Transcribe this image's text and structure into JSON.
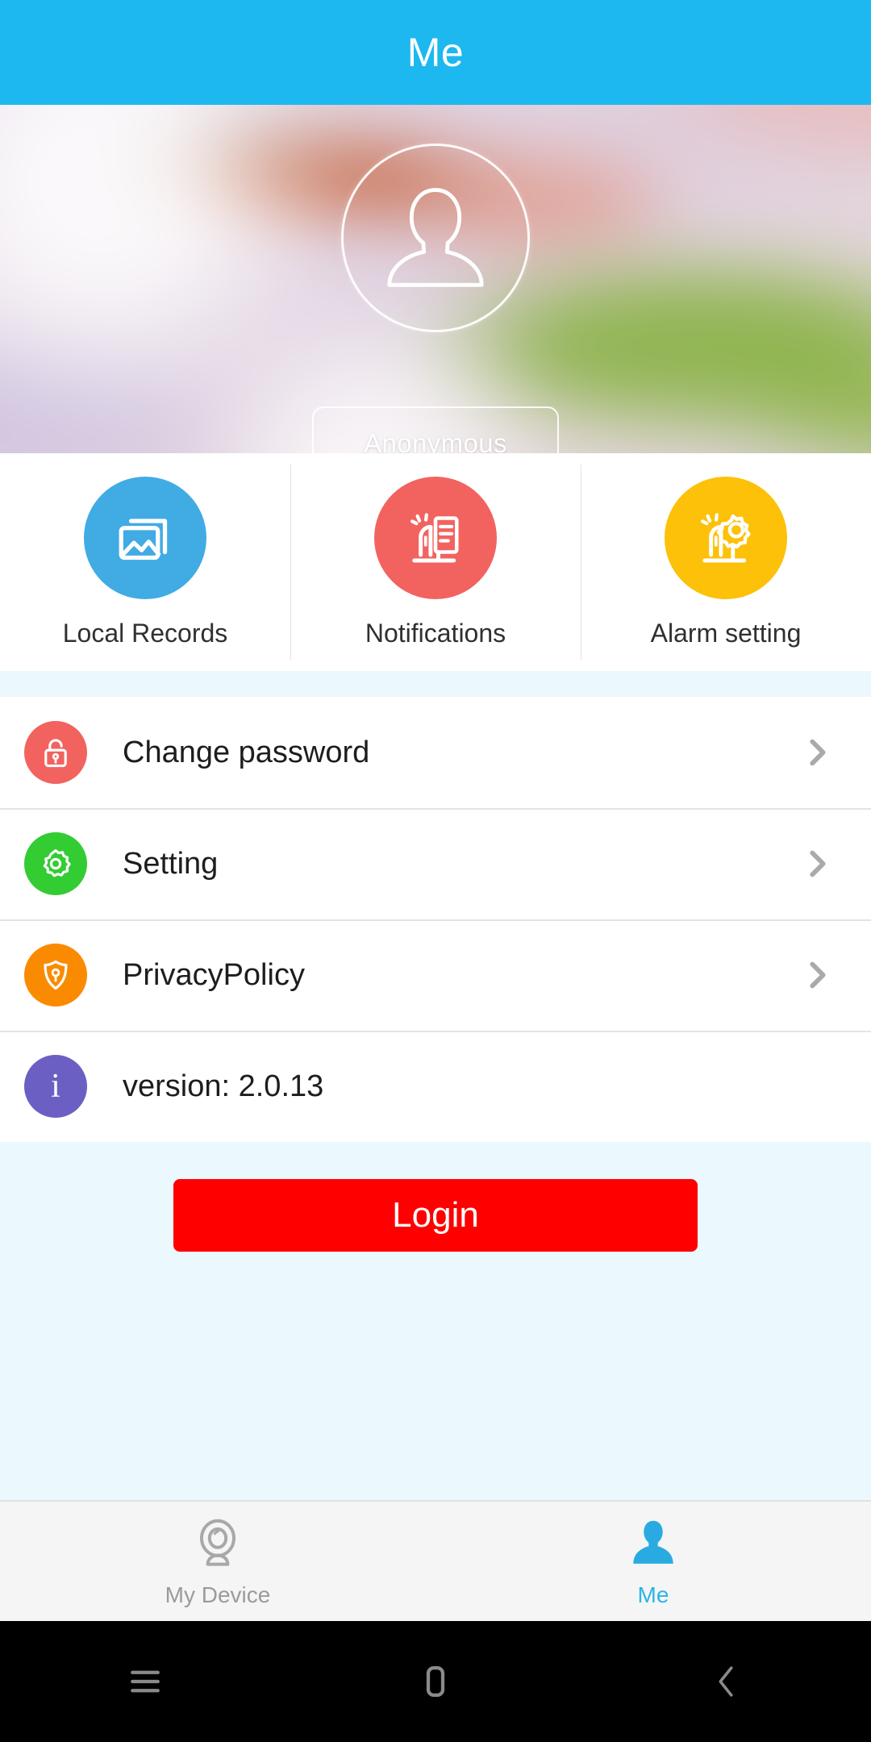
{
  "header": {
    "title": "Me"
  },
  "profile": {
    "avatar_icon": "person-outline-icon",
    "name_label": "Anonymous"
  },
  "quick_actions": [
    {
      "label": "Local Records",
      "icon": "gallery-icon",
      "color": "#41ABE4"
    },
    {
      "label": "Notifications",
      "icon": "siren-document-icon",
      "color": "#F2635F"
    },
    {
      "label": "Alarm setting",
      "icon": "siren-gear-icon",
      "color": "#FCC108"
    }
  ],
  "menu": [
    {
      "label": "Change password",
      "icon": "lock-icon",
      "color": "#F2635F",
      "chevron": true
    },
    {
      "label": "Setting",
      "icon": "gear-icon",
      "color": "#33CC33",
      "chevron": true
    },
    {
      "label": "PrivacyPolicy",
      "icon": "shield-icon",
      "color": "#FA8B00",
      "chevron": true
    },
    {
      "label": "version: 2.0.13",
      "icon": "info-icon",
      "color": "#6B5FC4",
      "chevron": false
    }
  ],
  "login": {
    "label": "Login",
    "color": "#FF0000"
  },
  "tabbar": [
    {
      "label": "My Device",
      "icon": "webcam-icon",
      "active": false
    },
    {
      "label": "Me",
      "icon": "person-icon",
      "active": true
    }
  ],
  "navbar": [
    {
      "icon": "menu-icon"
    },
    {
      "icon": "home-icon"
    },
    {
      "icon": "back-icon"
    }
  ],
  "colors": {
    "header": "#1CB8EF",
    "page_bg": "#EBF8FD",
    "accent": "#29B6E8",
    "chevron": "#AAAAAA"
  }
}
